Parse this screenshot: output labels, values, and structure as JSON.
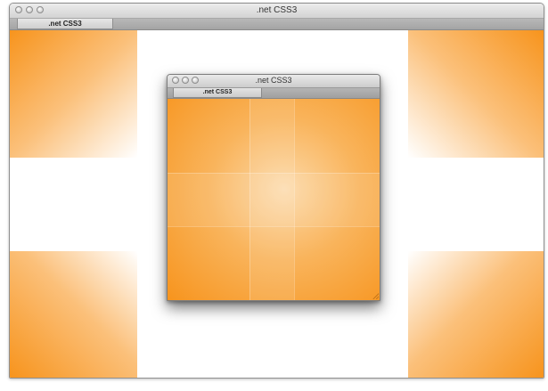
{
  "outer_window": {
    "title": ".net CSS3",
    "tab_label": ".net CSS3"
  },
  "inner_window": {
    "title": ".net CSS3",
    "tab_label": ".net CSS3"
  },
  "colors": {
    "accent_orange": "#f7941d",
    "light_orange": "#fbc07a",
    "background": "#ffffff"
  },
  "icons": {
    "window_controls": [
      "close-button-icon",
      "minimize-button-icon",
      "zoom-button-icon"
    ],
    "resize": "resize-grip-icon"
  }
}
